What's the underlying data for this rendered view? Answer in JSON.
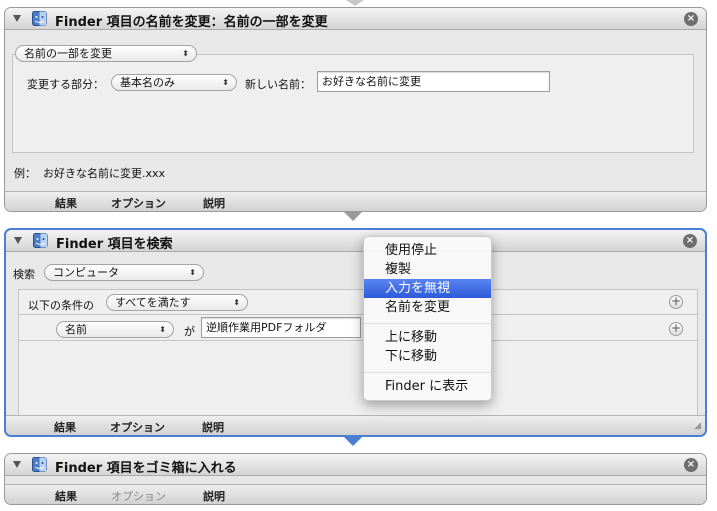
{
  "action1": {
    "title": "Finder 項目の名前を変更：名前の一部を変更",
    "mode_popup": "名前の一部を変更",
    "part_label": "変更する部分：",
    "part_popup": "基本名のみ",
    "newname_label": "新しい名前：",
    "newname_value": "お好きな名前に変更",
    "example_label": "例：",
    "example_value": "お好きな名前に変更.xxx",
    "tabs": [
      "結果",
      "オプション",
      "説明"
    ]
  },
  "action2": {
    "title": "Finder 項目を検索",
    "search_label": "検索",
    "search_popup": "コンピュータ",
    "cond_prefix": "以下の条件の",
    "cond_popup": "すべてを満たす",
    "row_popup": "名前",
    "row_op": "が",
    "row_value": "逆順作業用PDFフォルダ",
    "tabs": [
      "結果",
      "オプション",
      "説明"
    ]
  },
  "action3": {
    "title": "Finder 項目をゴミ箱に入れる",
    "tabs": [
      "結果",
      "オプション",
      "説明"
    ]
  },
  "context_menu": {
    "items": [
      "使用停止",
      "複製",
      "入力を無視",
      "名前を変更",
      "上に移動",
      "下に移動",
      "Finder に表示"
    ],
    "highlighted": "入力を無視"
  },
  "colors": {
    "selection_border": "#4a7fd4",
    "menu_highlight": "#3a66e0"
  }
}
